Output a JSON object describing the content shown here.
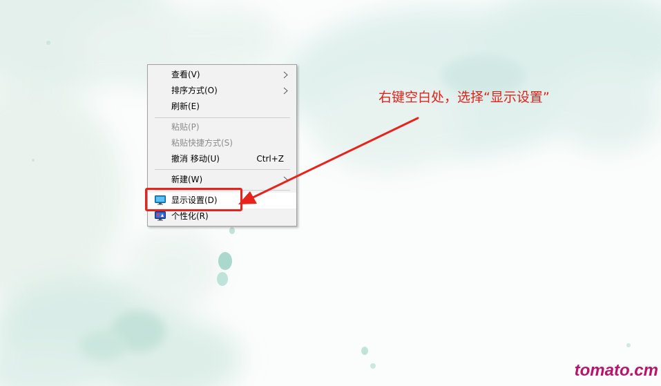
{
  "context_menu": {
    "items": [
      {
        "label": "查看(V)",
        "has_submenu": true
      },
      {
        "label": "排序方式(O)",
        "has_submenu": true
      },
      {
        "label": "刷新(E)"
      },
      {
        "label": "粘贴(P)",
        "disabled": true
      },
      {
        "label": "粘贴快捷方式(S)",
        "disabled": true
      },
      {
        "label": "撤消 移动(U)",
        "shortcut": "Ctrl+Z"
      },
      {
        "label": "新建(W)",
        "has_submenu": true
      },
      {
        "label": "显示设置(D)",
        "icon": "display-settings-icon",
        "highlighted": true
      },
      {
        "label": "个性化(R)",
        "icon": "personalize-icon"
      }
    ]
  },
  "annotation": {
    "text": "右键空白处，选择“显示设置”",
    "color": "#e0221a"
  },
  "watermark": {
    "text": "tomato.cm",
    "color": "#b8156a"
  }
}
